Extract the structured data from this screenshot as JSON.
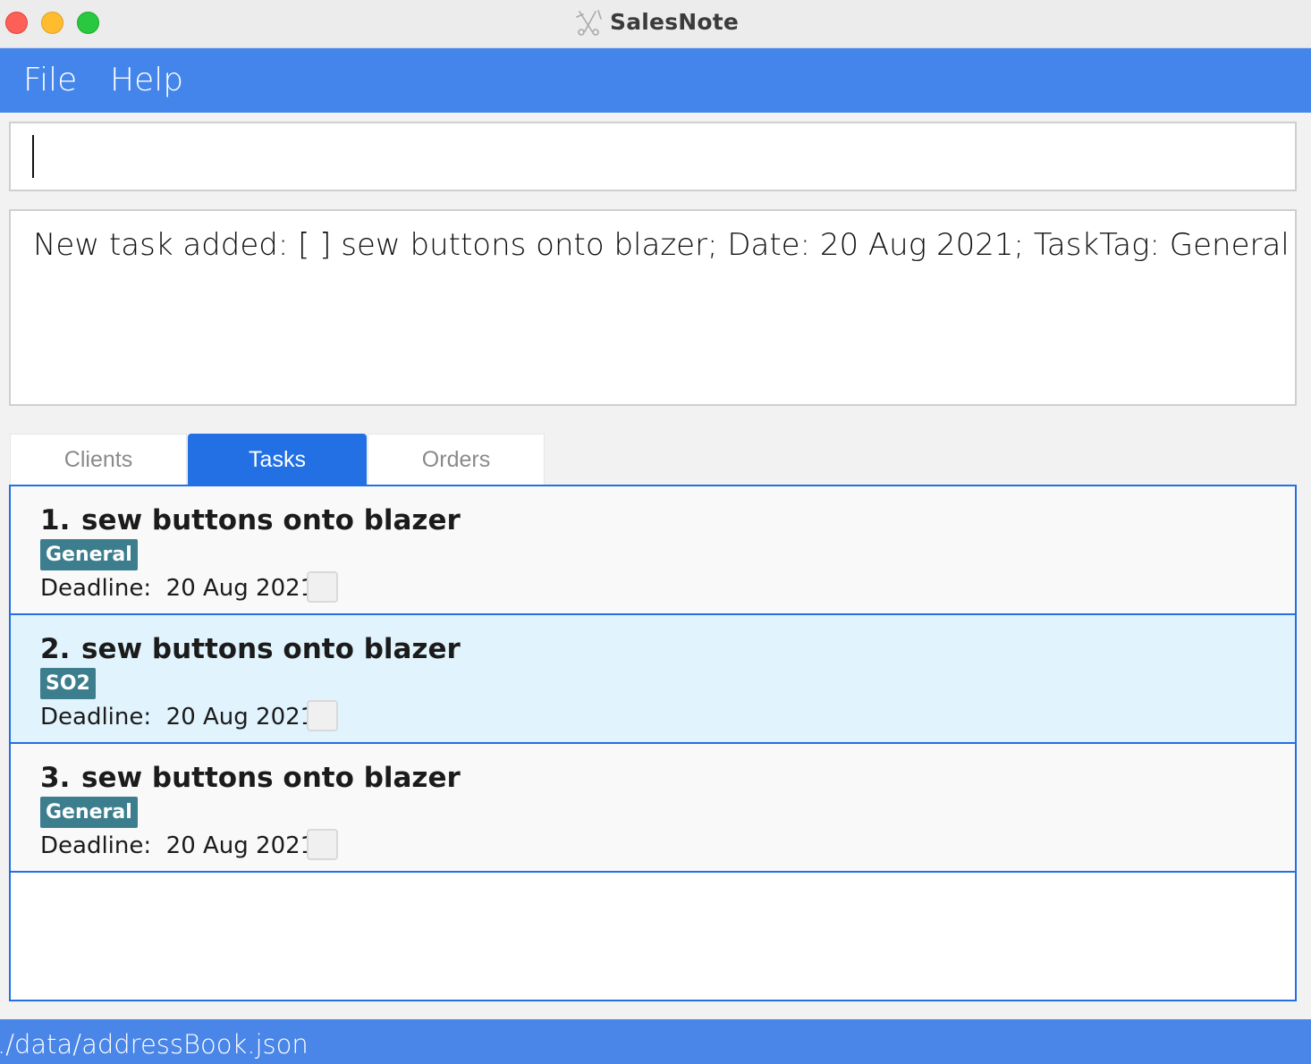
{
  "window": {
    "title": "SalesNote",
    "app_icon": "scissors-needle-icon"
  },
  "menu": {
    "items": [
      {
        "label": "File"
      },
      {
        "label": "Help"
      }
    ]
  },
  "command_box": {
    "value": ""
  },
  "result_display": {
    "text": "New task added: [ ] sew buttons onto blazer; Date: 20 Aug 2021; TaskTag: General"
  },
  "tabs": [
    {
      "label": "Clients",
      "selected": false
    },
    {
      "label": "Tasks",
      "selected": true
    },
    {
      "label": "Orders",
      "selected": false
    }
  ],
  "tasks": [
    {
      "index": "1.",
      "title": "sew buttons onto blazer",
      "tag": "General",
      "deadline_label": "Deadline:",
      "deadline": "20 Aug 2021",
      "done": false
    },
    {
      "index": "2.",
      "title": "sew buttons onto blazer",
      "tag": "SO2",
      "deadline_label": "Deadline:",
      "deadline": "20 Aug 2021",
      "done": false
    },
    {
      "index": "3.",
      "title": "sew buttons onto blazer",
      "tag": "General",
      "deadline_label": "Deadline:",
      "deadline": "20 Aug 2021",
      "done": false
    }
  ],
  "status_bar": {
    "path": "./data/addressBook.json"
  },
  "colors": {
    "menu_bar": "#4385ea",
    "tab_active": "#2270e4",
    "tag": "#3c7e8e",
    "selected_row": "#e1f3fc",
    "status_bar": "#4a86e8"
  }
}
